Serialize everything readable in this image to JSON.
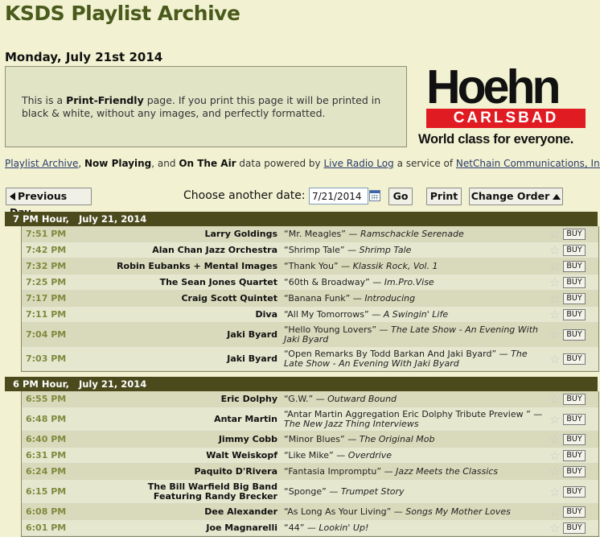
{
  "page": {
    "title": "KSDS Playlist Archive",
    "date_heading": "Monday, July 21st 2014"
  },
  "print_box": {
    "prefix": "This is a ",
    "bold": "Print-Friendly",
    "suffix": " page. If you print this page it will be printed in black & white, without any images, and perfectly formatted."
  },
  "ad": {
    "brand": "Hoehn",
    "location": "CARLSBAD",
    "tagline": "World class for everyone."
  },
  "powered_by": {
    "link1": "Playlist Archive",
    "sep1": ", ",
    "bold1": "Now Playing",
    "sep2": ", and ",
    "bold2": "On The Air",
    "mid": " data powered by ",
    "link2": "Live Radio Log",
    "mid2": " a service of ",
    "link3": "NetChain Communications, Inc."
  },
  "controls": {
    "prev_label": "Previous Day",
    "choose_label": "Choose another date:",
    "date_value": "7/21/2014",
    "go_label": "Go",
    "print_label": "Print",
    "order_label": "Change Order"
  },
  "hours": [
    {
      "header": "7 PM Hour,   July 21, 2014",
      "tracks": [
        {
          "time": "7:51 PM",
          "artist": "Larry Goldings",
          "song": "“Mr. Meagles”",
          "album": "Ramschackle Serenade",
          "buy": "BUY"
        },
        {
          "time": "7:42 PM",
          "artist": "Alan Chan Jazz Orchestra",
          "song": "“Shrimp Tale”",
          "album": "Shrimp Tale",
          "buy": "BUY"
        },
        {
          "time": "7:32 PM",
          "artist": "Robin Eubanks + Mental Images",
          "song": "“Thank You”",
          "album": "Klassik Rock, Vol. 1",
          "buy": "BUY"
        },
        {
          "time": "7:25 PM",
          "artist": "The Sean Jones Quartet",
          "song": "“60th & Broadway”",
          "album": "Im.Pro.Vise",
          "buy": "BUY"
        },
        {
          "time": "7:17 PM",
          "artist": "Craig Scott Quintet",
          "song": "“Banana Funk”",
          "album": "Introducing",
          "buy": "BUY"
        },
        {
          "time": "7:11 PM",
          "artist": "Diva",
          "song": "“All My Tomorrows”",
          "album": "A Swingin' Life",
          "buy": "BUY"
        },
        {
          "time": "7:04 PM",
          "artist": "Jaki Byard",
          "song": "“Hello Young Lovers”",
          "album": "The Late Show - An Evening With Jaki Byard",
          "buy": "BUY"
        },
        {
          "time": "7:03 PM",
          "artist": "Jaki Byard",
          "song": "“Open Remarks By Todd Barkan And Jaki Byard”",
          "album": "The Late Show - An Evening With Jaki Byard",
          "buy": "BUY"
        }
      ]
    },
    {
      "header": "6 PM Hour,   July 21, 2014",
      "tracks": [
        {
          "time": "6:55 PM",
          "artist": "Eric Dolphy",
          "song": "“G.W.”",
          "album": "Outward Bound",
          "buy": "BUY"
        },
        {
          "time": "6:48 PM",
          "artist": "Antar Martin",
          "song": "“Antar Martin Aggregation Eric Dolphy Tribute Preview ”",
          "album": "The New Jazz Thing Interviews",
          "buy": "BUY"
        },
        {
          "time": "6:40 PM",
          "artist": "Jimmy Cobb",
          "song": "“Minor Blues”",
          "album": "The Original Mob",
          "buy": "BUY"
        },
        {
          "time": "6:31 PM",
          "artist": "Walt Weiskopf",
          "song": "“Like Mike”",
          "album": "Overdrive",
          "buy": "BUY"
        },
        {
          "time": "6:24 PM",
          "artist": "Paquito D'Rivera",
          "song": "“Fantasia Impromptu”",
          "album": "Jazz Meets the Classics",
          "buy": "BUY"
        },
        {
          "time": "6:15 PM",
          "artist": "The Bill Warfield Big Band Featuring Randy Brecker",
          "song": "“Sponge”",
          "album": "Trumpet Story",
          "buy": "BUY"
        },
        {
          "time": "6:08 PM",
          "artist": "Dee Alexander",
          "song": "“As Long As Your Living”",
          "album": "Songs My Mother Loves",
          "buy": "BUY"
        },
        {
          "time": "6:01 PM",
          "artist": "Joe Magnarelli",
          "song": "“44”",
          "album": "Lookin' Up!",
          "buy": "BUY"
        }
      ]
    }
  ]
}
